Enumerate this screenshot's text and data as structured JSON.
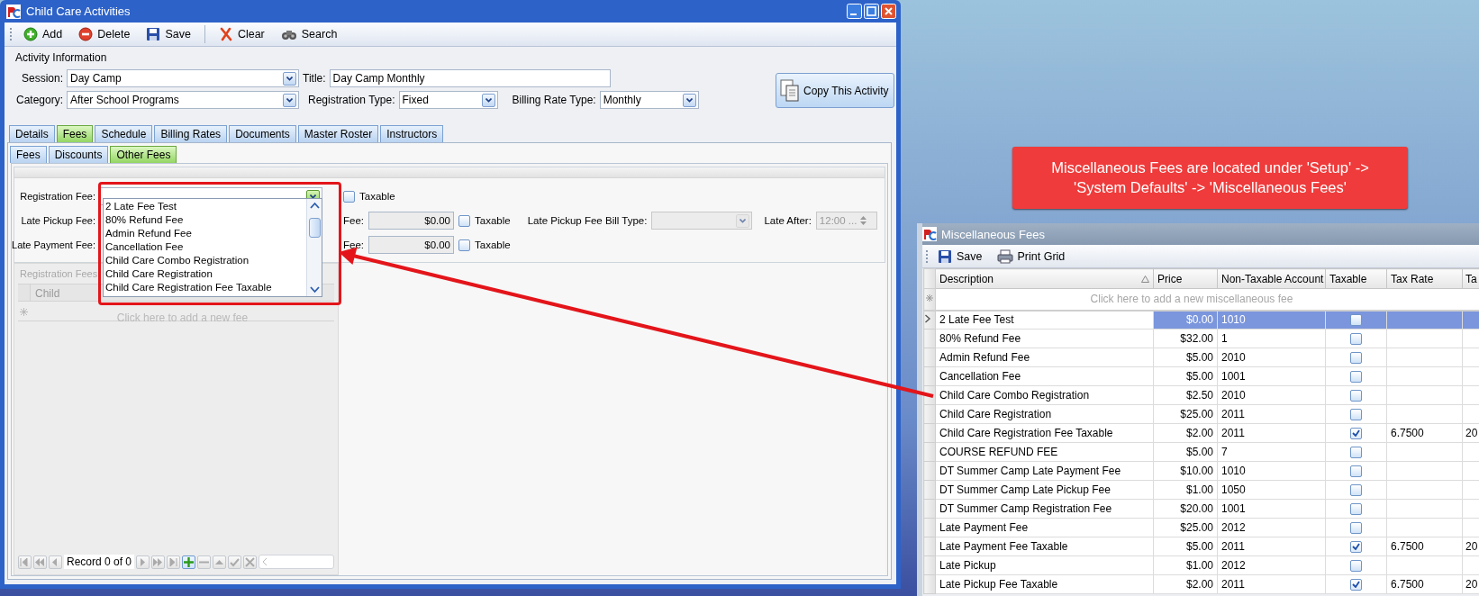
{
  "main_window": {
    "title": "Child Care Activities",
    "toolbar": [
      {
        "kind": "add",
        "label": "Add"
      },
      {
        "kind": "delete",
        "label": "Delete"
      },
      {
        "kind": "save",
        "label": "Save"
      },
      {
        "kind": "clear",
        "label": "Clear"
      },
      {
        "kind": "search",
        "label": "Search"
      }
    ],
    "section_heading": "Activity Information",
    "session": {
      "label": "Session:",
      "value": "Day Camp"
    },
    "title_field": {
      "label": "Title:",
      "value": "Day Camp Monthly"
    },
    "category": {
      "label": "Category:",
      "value": "After School Programs"
    },
    "registration_type": {
      "label": "Registration Type:",
      "value": "Fixed"
    },
    "billing_rate_type": {
      "label": "Billing Rate Type:",
      "value": "Monthly"
    },
    "copy_button": "Copy This Activity",
    "tabs": [
      {
        "label": "Details",
        "selected": false
      },
      {
        "label": "Fees",
        "selected": true
      },
      {
        "label": "Schedule",
        "selected": false
      },
      {
        "label": "Billing Rates",
        "selected": false
      },
      {
        "label": "Documents",
        "selected": false
      },
      {
        "label": "Master Roster",
        "selected": false
      },
      {
        "label": "Instructors",
        "selected": false
      }
    ],
    "subtabs": [
      {
        "label": "Fees",
        "selected": false
      },
      {
        "label": "Discounts",
        "selected": false
      },
      {
        "label": "Other Fees",
        "selected": true
      }
    ],
    "other_fees": {
      "registration_fee": {
        "label": "Registration Fee:",
        "taxable": {
          "label": "Taxable",
          "checked": false
        }
      },
      "late_pickup_fee": {
        "label": "Late Pickup Fee:",
        "fee_label": "Fee:",
        "fee": "$0.00",
        "taxable": {
          "label": "Taxable",
          "checked": false
        },
        "bill_type_label": "Late Pickup Fee Bill Type:",
        "bill_type_disabled": true,
        "late_after_label": "Late After:",
        "late_after": "12:00 ...",
        "late_after_disabled": true
      },
      "late_payment_fee": {
        "label": "Late Payment Fee:",
        "fee_label": "Fee:",
        "fee": "$0.00",
        "taxable": {
          "label": "Taxable",
          "checked": false
        }
      },
      "dropdown": {
        "items": [
          "2 Late Fee Test",
          "80% Refund Fee",
          "Admin Refund Fee",
          "Cancellation Fee",
          "Child Care Combo Registration",
          "Child Care Registration",
          "Child Care Registration Fee Taxable"
        ]
      }
    },
    "registration_fees": {
      "heading": "Registration Fees",
      "disabled": true,
      "columns": [
        "Child"
      ],
      "new_row": "Click here to add a new fee",
      "record": "Record 0 of 0"
    }
  },
  "callout": {
    "lines": [
      "Miscellaneous Fees are located under 'Setup' ->",
      "'System Defaults' -> 'Miscellaneous Fees'"
    ]
  },
  "misc_window": {
    "title": "Miscellaneous Fees",
    "toolbar": [
      {
        "kind": "save",
        "label": "Save"
      },
      {
        "kind": "print",
        "label": "Print Grid"
      }
    ],
    "columns": [
      "Description",
      "Price",
      "Non-Taxable Account",
      "Taxable",
      "Tax Rate",
      "Ta"
    ],
    "new_row": "Click here to add a new miscellaneous fee",
    "rows": [
      {
        "description": "2 Late Fee Test",
        "price": "$0.00",
        "account": "1010",
        "taxable": false,
        "tax_rate": null,
        "column_6": null,
        "selected": true
      },
      {
        "description": "80% Refund Fee",
        "price": "$32.00",
        "account": "1",
        "taxable": false,
        "tax_rate": null,
        "column_6": null,
        "selected": false
      },
      {
        "description": "Admin Refund Fee",
        "price": "$5.00",
        "account": "2010",
        "taxable": false,
        "tax_rate": null,
        "column_6": null,
        "selected": false
      },
      {
        "description": "Cancellation Fee",
        "price": "$5.00",
        "account": "1001",
        "taxable": false,
        "tax_rate": null,
        "column_6": null,
        "selected": false
      },
      {
        "description": "Child Care Combo Registration",
        "price": "$2.50",
        "account": "2010",
        "taxable": false,
        "tax_rate": null,
        "column_6": null,
        "selected": false
      },
      {
        "description": "Child Care Registration",
        "price": "$25.00",
        "account": "2011",
        "taxable": false,
        "tax_rate": null,
        "column_6": null,
        "selected": false
      },
      {
        "description": "Child Care Registration Fee Taxable",
        "price": "$2.00",
        "account": "2011",
        "taxable": true,
        "tax_rate": "6.7500",
        "column_6": "20",
        "selected": false
      },
      {
        "description": "COURSE REFUND FEE",
        "price": "$5.00",
        "account": "7",
        "taxable": false,
        "tax_rate": null,
        "column_6": null,
        "selected": false
      },
      {
        "description": "DT Summer Camp Late Payment Fee",
        "price": "$10.00",
        "account": "1010",
        "taxable": false,
        "tax_rate": null,
        "column_6": null,
        "selected": false
      },
      {
        "description": "DT Summer Camp Late Pickup Fee",
        "price": "$1.00",
        "account": "1050",
        "taxable": false,
        "tax_rate": null,
        "column_6": null,
        "selected": false
      },
      {
        "description": "DT Summer Camp Registration Fee",
        "price": "$20.00",
        "account": "1001",
        "taxable": false,
        "tax_rate": null,
        "column_6": null,
        "selected": false
      },
      {
        "description": "Late Payment Fee",
        "price": "$25.00",
        "account": "2012",
        "taxable": false,
        "tax_rate": null,
        "column_6": null,
        "selected": false
      },
      {
        "description": "Late Payment Fee Taxable",
        "price": "$5.00",
        "account": "2011",
        "taxable": true,
        "tax_rate": "6.7500",
        "column_6": "20",
        "selected": false
      },
      {
        "description": "Late Pickup",
        "price": "$1.00",
        "account": "2012",
        "taxable": false,
        "tax_rate": null,
        "column_6": null,
        "selected": false
      },
      {
        "description": "Late Pickup Fee Taxable",
        "price": "$2.00",
        "account": "2011",
        "taxable": true,
        "tax_rate": "6.7500",
        "column_6": "20",
        "selected": false
      }
    ]
  }
}
